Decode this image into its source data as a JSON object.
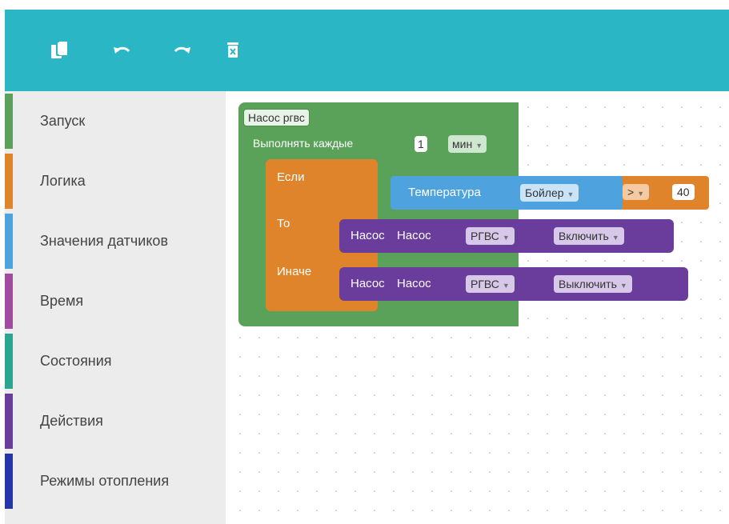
{
  "toolbar": {
    "buttons": [
      {
        "name": "copy-icon"
      },
      {
        "name": "undo-icon"
      },
      {
        "name": "redo-icon"
      },
      {
        "name": "trash-icon"
      }
    ]
  },
  "sidebar": {
    "categories": [
      {
        "label": "Запуск",
        "color": "#5aa259"
      },
      {
        "label": "Логика",
        "color": "#e0842b"
      },
      {
        "label": "Значения датчиков",
        "color": "#4ea3de"
      },
      {
        "label": "Время",
        "color": "#a04aa0"
      },
      {
        "label": "Состояния",
        "color": "#29a591"
      },
      {
        "label": "Действия",
        "color": "#6a3c9c"
      },
      {
        "label": "Режимы отопления",
        "color": "#2537a8"
      }
    ]
  },
  "workspace": {
    "event_block": {
      "name": "Насос ргвс",
      "repeat_label": "Выполнять каждые",
      "interval": "1",
      "unit": "мин"
    },
    "if_block": {
      "if_label": "Если",
      "then_label": "То",
      "else_label": "Иначе"
    },
    "condition": {
      "sensor_label": "Температура",
      "sensor_value": "Бойлер",
      "operator": ">",
      "threshold": "40"
    },
    "then_action": {
      "label1": "Насос",
      "label2": "Насос",
      "device": "РГВС",
      "command": "Включить"
    },
    "else_action": {
      "label1": "Насос",
      "label2": "Насос",
      "device": "РГВС",
      "command": "Выключить"
    }
  }
}
